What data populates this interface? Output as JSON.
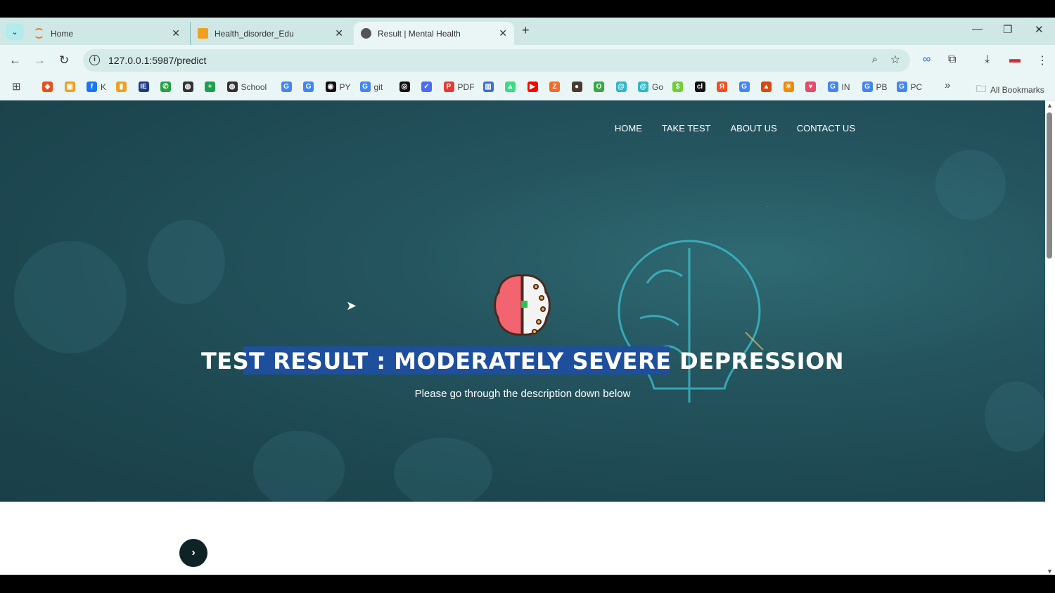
{
  "browser": {
    "tabs": [
      {
        "title": "Home",
        "icon": "loading-icon",
        "color": "#f07c2a"
      },
      {
        "title": "Health_disorder_Edu",
        "icon": "book-icon",
        "color": "#f0a020"
      },
      {
        "title": "Result | Mental Health",
        "icon": "globe-icon",
        "color": "#555555",
        "active": true
      }
    ],
    "new_tab": "+",
    "url": "127.0.0.1:5987/predict",
    "bookmarks": [
      {
        "label": "",
        "glyph": "◆",
        "color": "#e8501a"
      },
      {
        "label": "",
        "glyph": "▣",
        "color": "#f0a020"
      },
      {
        "label": "K",
        "glyph": "f",
        "color": "#1877f2"
      },
      {
        "label": "",
        "glyph": "▮",
        "color": "#f0a020"
      },
      {
        "label": "",
        "glyph": "IE",
        "color": "#1a3a8a"
      },
      {
        "label": "",
        "glyph": "✆",
        "color": "#25a244"
      },
      {
        "label": "",
        "glyph": "◍",
        "color": "#333333"
      },
      {
        "label": "",
        "glyph": "+",
        "color": "#1f9e50"
      },
      {
        "label": "School",
        "glyph": "◍",
        "color": "#333333"
      },
      {
        "label": "",
        "glyph": "G",
        "color": "#4285f4"
      },
      {
        "label": "",
        "glyph": "G",
        "color": "#4285f4"
      },
      {
        "label": "PY",
        "glyph": "◉",
        "color": "#111111"
      },
      {
        "label": "git",
        "glyph": "G",
        "color": "#4285f4"
      },
      {
        "label": "",
        "glyph": "◎",
        "color": "#111111"
      },
      {
        "label": "",
        "glyph": "✓",
        "color": "#4a6cf7"
      },
      {
        "label": "PDF",
        "glyph": "P",
        "color": "#e53935"
      },
      {
        "label": "",
        "glyph": "▥",
        "color": "#3a6fd8"
      },
      {
        "label": "",
        "glyph": "▲",
        "color": "#3ddc84"
      },
      {
        "label": "",
        "glyph": "▶",
        "color": "#ff0000"
      },
      {
        "label": "",
        "glyph": "Z",
        "color": "#f26b2a"
      },
      {
        "label": "",
        "glyph": "●",
        "color": "#4a3a30"
      },
      {
        "label": "",
        "glyph": "O",
        "color": "#3aa845"
      },
      {
        "label": "",
        "glyph": "@",
        "color": "#2fb8c8"
      },
      {
        "label": "Go",
        "glyph": "@",
        "color": "#2fb8c8"
      },
      {
        "label": "",
        "glyph": "$",
        "color": "#6fcf3a"
      },
      {
        "label": "",
        "glyph": "cl",
        "color": "#111111"
      },
      {
        "label": "",
        "glyph": "Я",
        "color": "#f04e23"
      },
      {
        "label": "",
        "glyph": "G",
        "color": "#4285f4"
      },
      {
        "label": "",
        "glyph": "▲",
        "color": "#d9480f"
      },
      {
        "label": "",
        "glyph": "☀",
        "color": "#f08a00"
      },
      {
        "label": "",
        "glyph": "♥",
        "color": "#e84a6a"
      },
      {
        "label": "IN",
        "glyph": "G",
        "color": "#4285f4"
      },
      {
        "label": "PB",
        "glyph": "G",
        "color": "#4285f4"
      },
      {
        "label": "PC",
        "glyph": "G",
        "color": "#4285f4"
      }
    ],
    "more": "»",
    "all_bookmarks": "All Bookmarks"
  },
  "page": {
    "menu": [
      "HOME",
      "TAKE TEST",
      "ABOUT US",
      "CONTACT US"
    ],
    "result_title": "TEST RESULT : MODERATELY SEVERE DEPRESSION",
    "subtitle": "Please go through the description down below",
    "next": "›"
  }
}
